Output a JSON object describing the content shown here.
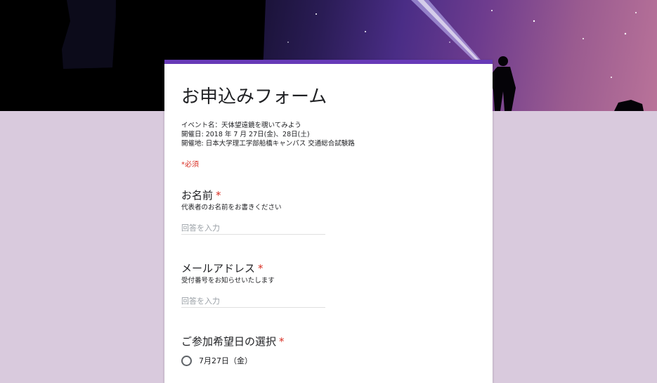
{
  "form": {
    "title": "お申込みフォーム",
    "description": [
      "イベント名：天体望遠鏡を覗いてみよう",
      "開催日: 2018 年 7 月 27日(金)、28日(土)",
      "開催地: 日本大学理工学部船橋キャンパス 交通総合試験路"
    ],
    "required_note": "*必須",
    "accent_color": "#673ab7"
  },
  "questions": [
    {
      "title": "お名前",
      "required_mark": "*",
      "help": "代表者のお名前をお書きください",
      "placeholder": "回答を入力"
    },
    {
      "title": "メールアドレス",
      "required_mark": "*",
      "help": "受付番号をお知らせいたします",
      "placeholder": "回答を入力"
    },
    {
      "title": "ご参加希望日の選択",
      "required_mark": "*",
      "options": [
        "7月27日（金）"
      ]
    }
  ]
}
